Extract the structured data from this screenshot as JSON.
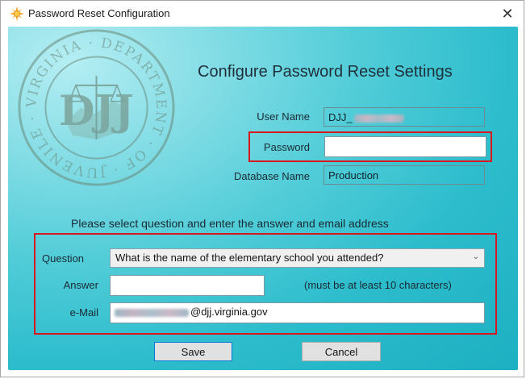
{
  "window": {
    "title": "Password Reset Configuration",
    "icon": "sun-star-icon",
    "close_glyph": "✕"
  },
  "logo": {
    "name": "seal-logo",
    "ring_text": "VIRGINIA · DEPARTMENT · OF · JUVENILE · JUSTICE",
    "monogram": "DJJ"
  },
  "heading": "Configure Password Reset Settings",
  "account": {
    "user_name_label": "User Name",
    "user_name_value": "DJJ_",
    "password_label": "Password",
    "password_value": "",
    "database_label": "Database Name",
    "database_value": "Production"
  },
  "instruction": "Please select question and enter the answer and email address",
  "security": {
    "question_label": "Question",
    "question_selected": "What is the name of the elementary school you attended?",
    "answer_label": "Answer",
    "answer_value": "",
    "answer_hint": "(must be at least 10 characters)",
    "email_label": "e-Mail",
    "email_value": "@djj.virginia.gov"
  },
  "buttons": {
    "save": "Save",
    "cancel": "Cancel"
  },
  "colors": {
    "highlight": "#d7191f",
    "background_teal": "#2cbccc",
    "accent_blue": "#0078d7"
  }
}
